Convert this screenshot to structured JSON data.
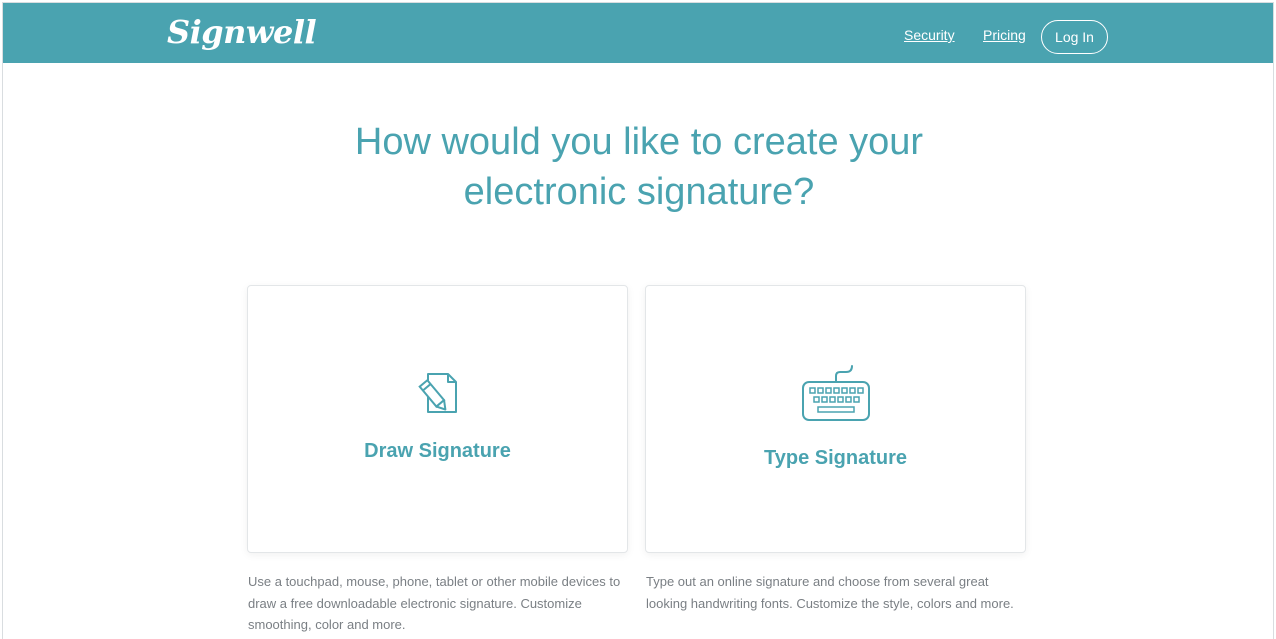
{
  "header": {
    "logo_text": "Signwell",
    "nav": {
      "security": "Security",
      "pricing": "Pricing",
      "login": "Log In"
    },
    "bg_color": "#4aa3b0"
  },
  "main": {
    "headline_line1": "How would you like to create your",
    "headline_line2": "electronic signature?",
    "options": [
      {
        "title": "Draw Signature",
        "icon": "pencil-document-icon",
        "description": "Use a touchpad, mouse, phone, tablet or other mobile devices to draw a free downloadable electronic signature. Customize smoothing, color and more."
      },
      {
        "title": "Type Signature",
        "icon": "keyboard-icon",
        "description": "Type out an online signature and choose from several great looking handwriting fonts. Customize the style, colors and more."
      }
    ]
  },
  "colors": {
    "accent": "#4aa3b0",
    "text_muted": "#7a7f84"
  }
}
